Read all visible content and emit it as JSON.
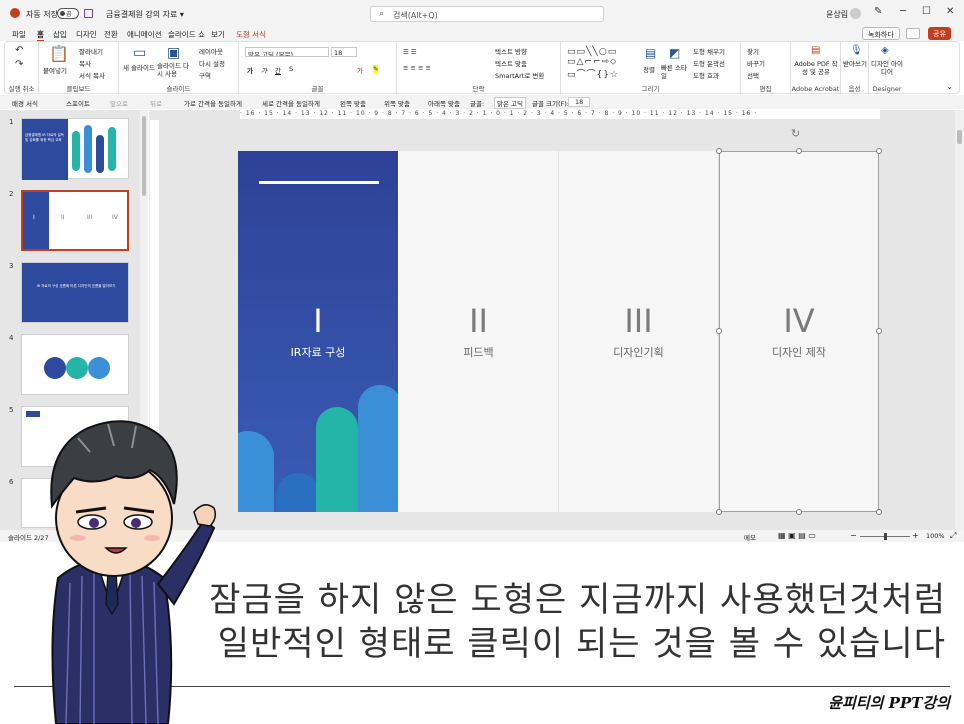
{
  "titlebar": {
    "autosave_label": "자동 저장",
    "autosave_state": "끔",
    "doc_title": "금융결제원 강의 자료 ▾",
    "search_placeholder": "검색(Alt+Q)",
    "user_name": "윤상림"
  },
  "menu": {
    "tabs": [
      "파일",
      "홈",
      "삽입",
      "디자인",
      "전환",
      "애니메이션",
      "슬라이드 쇼",
      "보기",
      "도형 서식"
    ],
    "record": "녹화하다",
    "share": "공유"
  },
  "ribbon": {
    "groups": [
      "실행 취소",
      "클립보드",
      "슬라이드",
      "글꼴",
      "단락",
      "그리기",
      "편집",
      "Adobe Acrobat",
      "음성",
      "Designer"
    ],
    "clipboard": {
      "paste": "붙여넣기",
      "cut": "잘라내기",
      "copy": "복사",
      "format_painter": "서식 복사"
    },
    "slides": {
      "new_slide": "새 슬라이드",
      "reuse": "슬라이드 다시 사용",
      "layout": "레이아웃",
      "reset": "다시 설정",
      "section": "구역"
    },
    "font": {
      "name": "맑은 고딕 (본문)",
      "size": "18"
    },
    "paragraph": {
      "text_direction": "텍스트 방향",
      "align_text": "텍스트 맞춤",
      "smartart": "SmartArt로 변환"
    },
    "drawing": {
      "arrange": "정렬",
      "quick_styles": "빠른 스타일",
      "fill": "도형 채우기",
      "outline": "도형 윤곽선",
      "effects": "도형 효과"
    },
    "editing": {
      "find": "찾기",
      "replace": "바꾸기",
      "select": "선택"
    },
    "acrobat": {
      "create": "Adobe PDF 작성 및 공유"
    },
    "voice": {
      "dictate": "받아쓰기"
    },
    "designer": {
      "label": "디자인 아이디어"
    }
  },
  "format_bar": {
    "items": [
      "배경 서식",
      "스포이트",
      "앞으로",
      "뒤로",
      "가로 간격을 동일하게",
      "세로 간격을 동일하게",
      "왼쪽 맞춤",
      "위쪽 맞춤",
      "아래쪽 맞춤"
    ],
    "font_label": "글꼴:",
    "font_value": "맑은 고딕",
    "size_label": "글꼴 크기(F):",
    "size_value": "18"
  },
  "ruler": {
    "top": "· 16 · 15 · 14 · 13 · 12 · 11 · 10 · 9 · 8 · 7 · 6 · 5 · 4 · 3 · 2 · 1 · 0 · 1 · 2 · 3 · 4 · 5 · 6 · 7 · 8 · 9 · 10 · 11 · 12 · 13 · 14 · 15 · 16 ·"
  },
  "thumbnails": [
    {
      "num": "1",
      "title": "금융결제원 IR 자료의 설득 및 강화를 위한 핵심 교육"
    },
    {
      "num": "2",
      "labels": [
        "I",
        "II",
        "III",
        "IV"
      ]
    },
    {
      "num": "3",
      "title": "IR 자료의 구성 흐름에 따른 디자인의 흐름을 알아보기"
    },
    {
      "num": "4"
    },
    {
      "num": "5"
    },
    {
      "num": "6"
    }
  ],
  "slide": {
    "columns": [
      {
        "roman": "I",
        "label": "IR자료 구성"
      },
      {
        "roman": "II",
        "label": "피드백"
      },
      {
        "roman": "III",
        "label": "디자인기획"
      },
      {
        "roman": "IV",
        "label": "디자인 제작"
      }
    ]
  },
  "statusbar": {
    "slide_count": "슬라이드 2/27",
    "notes": "메모",
    "zoom": "100%"
  },
  "caption": {
    "line1": "잠금을 하지 않은 도형은 지금까지 사용했던것처럼",
    "line2": "일반적인 형태로 클릭이 되는 것을 볼 수 있습니다",
    "signature": "윤피티의 PPT강의"
  },
  "colors": {
    "accent_red": "#c43e1c",
    "slide_blue": "#2e4a9e",
    "teal": "#25b5a8",
    "sky": "#3a8fd6"
  }
}
